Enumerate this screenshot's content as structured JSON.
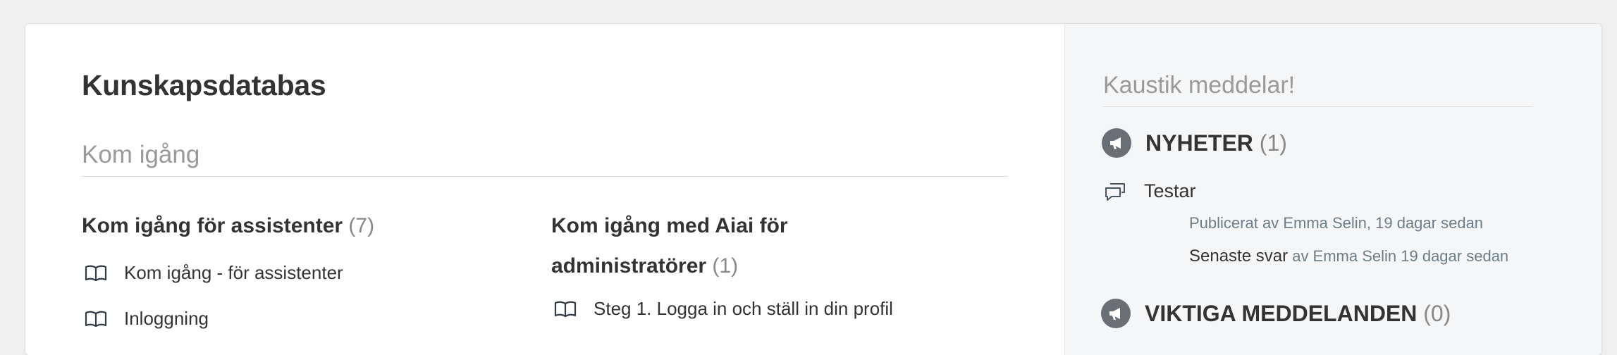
{
  "page": {
    "title": "Kunskapsdatabas",
    "section_title": "Kom igång",
    "categories": [
      {
        "title": "Kom igång för assistenter",
        "count": "(7)",
        "articles": [
          {
            "label": "Kom igång - för assistenter",
            "icon": "book-icon"
          },
          {
            "label": "Inloggning",
            "icon": "book-icon"
          }
        ]
      },
      {
        "title_line1": "Kom igång med Aiai för",
        "title_line2": "administratörer",
        "count": "(1)",
        "articles": [
          {
            "label": "Steg 1. Logga in och ställ in din profil",
            "icon": "book-icon"
          }
        ]
      }
    ]
  },
  "aside": {
    "title": "Kaustik meddelar!",
    "news": {
      "label": "NYHETER",
      "count": "(1)",
      "icon": "megaphone-icon",
      "topics": [
        {
          "title": "Testar",
          "icon": "discussion-icon",
          "published_prefix": "Publicerat av",
          "published_by": "Emma Selin",
          "published_when": ", 19 dagar sedan",
          "reply_label": "Senaste svar",
          "reply_meta": "av Emma Selin 19 dagar sedan"
        }
      ]
    },
    "important": {
      "label": "VIKTIGA MEDDELANDEN",
      "count": "(0)",
      "icon": "megaphone-icon"
    }
  },
  "colors": {
    "background": "#efefef",
    "card": "#ffffff",
    "aside_background": "#f5f6f7",
    "muted_text": "#999999",
    "meta_text": "#6b7c8a",
    "icon_circle": "#6a6e75"
  }
}
